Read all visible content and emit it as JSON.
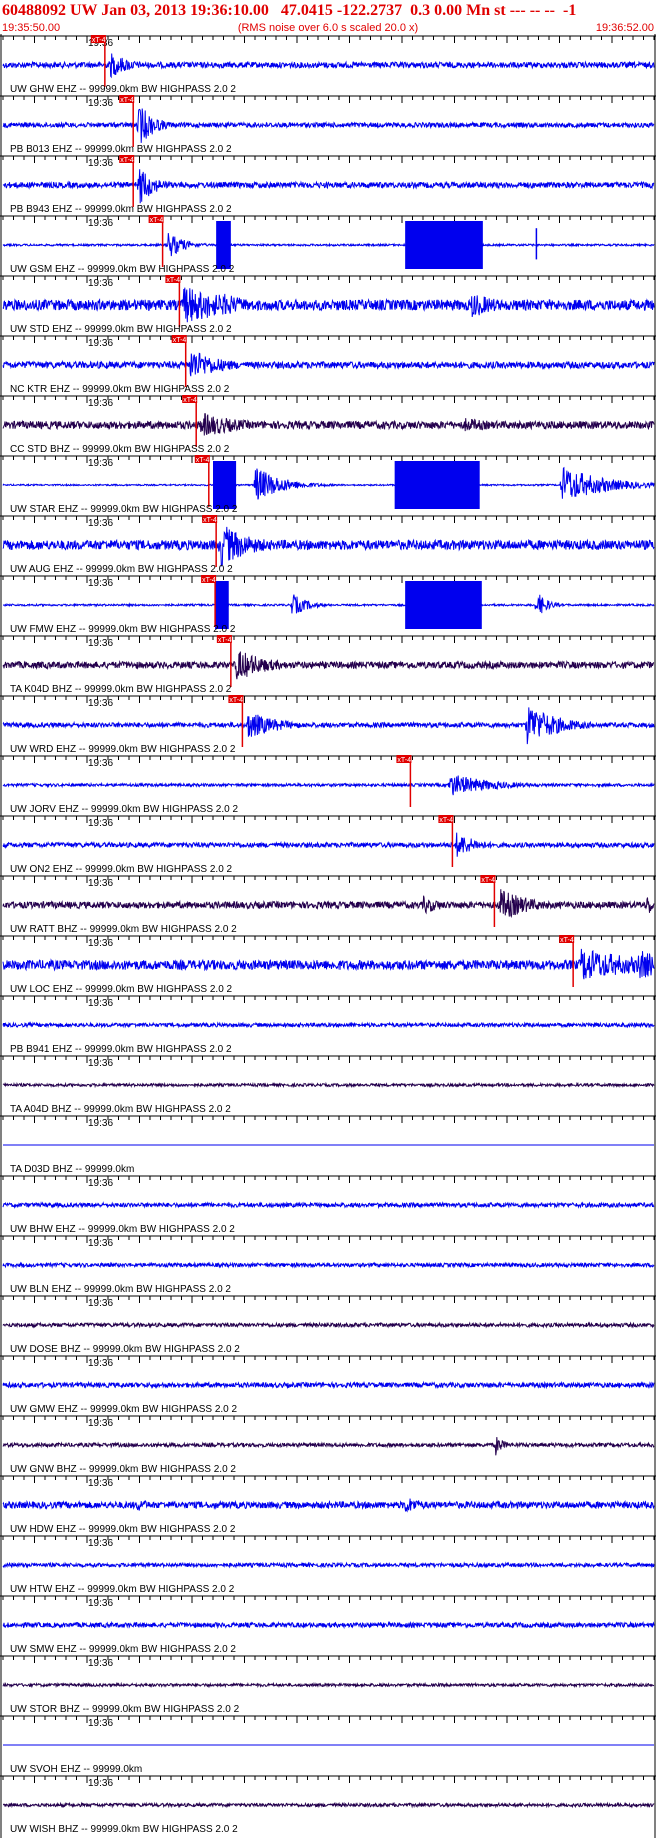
{
  "header": {
    "title": "60488092 UW Jan 03, 2013 19:36:10.00   47.0415 -122.2737  0.3 0.00 Mn st --- -- --  -1",
    "start_time": "19:35:50.00",
    "note": "(RMS noise over 6.0 s scaled 20.0 x)",
    "end_time": "19:36:52.00"
  },
  "chart_data": {
    "type": "line",
    "title": "60488092 UW Jan 03, 2013 19:36:10.00   47.0415 -122.2737  0.3 0.00 Mn st --- -- --  -1",
    "x_start": "19:35:50.00",
    "x_end": "19:36:52.00",
    "x_range_seconds": [
      0,
      62
    ],
    "minute_tick_label": "19:36",
    "minute_tick_time_s": 8,
    "pick_label": "xT-4",
    "colors": {
      "header": "#e00000",
      "trace_blue": "#0000ee",
      "trace_dark": "#24004d",
      "pick": "#e00000",
      "axis": "#000000"
    },
    "traces": [
      {
        "name": "UW GHW EHZ -- 99999.0km BW  HIGHPASS  2.0  2",
        "color": "blue",
        "pick_s": 9.7,
        "noise": 0.12,
        "events": [
          {
            "t": 10.2,
            "amp": 0.55,
            "dur": 2
          }
        ]
      },
      {
        "name": "PB B013 EHZ -- 99999.0km BW  HIGHPASS  2.0  2",
        "color": "blue",
        "pick_s": 12.4,
        "noise": 0.1,
        "events": [
          {
            "t": 12.9,
            "amp": 0.95,
            "dur": 1.5
          }
        ]
      },
      {
        "name": "PB B943 EHZ -- 99999.0km BW  HIGHPASS  2.0  2",
        "color": "blue",
        "pick_s": 12.4,
        "noise": 0.12,
        "events": [
          {
            "t": 12.9,
            "amp": 0.9,
            "dur": 1.5
          }
        ]
      },
      {
        "name": "UW GSM EHZ -- 99999.0km BW  HIGHPASS  2.0  2",
        "color": "blue",
        "pick_s": 15.2,
        "noise": 0.04,
        "events": [
          {
            "t": 15.7,
            "amp": 0.6,
            "dur": 1.5
          }
        ],
        "blocks": [
          [
            20.3,
            21.7
          ],
          [
            38.3,
            45.7
          ]
        ],
        "spikes": [
          50.8
        ]
      },
      {
        "name": "UW STD EHZ -- 99999.0km BW  HIGHPASS  2.0  2",
        "color": "blue",
        "pick_s": 16.8,
        "noise": 0.22,
        "events": [
          {
            "t": 17.2,
            "amp": 0.85,
            "dur": 5
          },
          {
            "t": 21,
            "amp": 0.5,
            "dur": 3
          },
          {
            "t": 44.6,
            "amp": 0.55,
            "dur": 3
          }
        ]
      },
      {
        "name": "NC KTR EHZ -- 99999.0km BW  HIGHPASS  2.0  2",
        "color": "blue",
        "pick_s": 17.4,
        "noise": 0.14,
        "events": [
          {
            "t": 17.8,
            "amp": 0.7,
            "dur": 3
          }
        ]
      },
      {
        "name": "CC STD BHZ -- 99999.0km BW  HIGHPASS  2.0  2",
        "color": "dark",
        "pick_s": 18.4,
        "noise": 0.16,
        "events": [
          {
            "t": 18.8,
            "amp": 0.55,
            "dur": 4
          },
          {
            "t": 44,
            "amp": 0.3,
            "dur": 4
          }
        ]
      },
      {
        "name": "UW STAR EHZ -- 99999.0km BW  HIGHPASS  2.0  2",
        "color": "blue",
        "pick_s": 19.6,
        "noise": 0.03,
        "events": [
          {
            "t": 24,
            "amp": 0.8,
            "dur": 2.5
          },
          {
            "t": 53.2,
            "amp": 0.8,
            "dur": 4
          }
        ],
        "blocks": [
          [
            20,
            22.2
          ],
          [
            37.3,
            45.4
          ]
        ]
      },
      {
        "name": "UW AUG EHZ -- 99999.0km BW  HIGHPASS  2.0  2",
        "color": "blue",
        "pick_s": 20.3,
        "noise": 0.2,
        "events": [
          {
            "t": 20.7,
            "amp": 0.95,
            "dur": 3
          }
        ]
      },
      {
        "name": "UW FMW EHZ -- 99999.0km BW  HIGHPASS  2.0  2",
        "color": "blue",
        "pick_s": 20.2,
        "noise": 0.04,
        "events": [
          {
            "t": 27.5,
            "amp": 0.5,
            "dur": 1.5
          },
          {
            "t": 50.8,
            "amp": 0.6,
            "dur": 1
          }
        ],
        "blocks": [
          [
            20.2,
            21.5
          ],
          [
            38.3,
            45.6
          ]
        ]
      },
      {
        "name": "TA K04D BHZ -- 99999.0km BW  HIGHPASS  2.0  2",
        "color": "dark",
        "pick_s": 21.7,
        "noise": 0.14,
        "events": [
          {
            "t": 22.2,
            "amp": 0.7,
            "dur": 3
          }
        ]
      },
      {
        "name": "UW WRD EHZ -- 99999.0km BW  HIGHPASS  2.0  2",
        "color": "blue",
        "pick_s": 22.8,
        "noise": 0.1,
        "events": [
          {
            "t": 23.3,
            "amp": 0.6,
            "dur": 3
          },
          {
            "t": 49.9,
            "amp": 0.9,
            "dur": 3
          }
        ]
      },
      {
        "name": "UW JORV EHZ -- 99999.0km BW  HIGHPASS  2.0  2",
        "color": "blue",
        "pick_s": 38.8,
        "noise": 0.06,
        "events": [
          {
            "t": 42.5,
            "amp": 0.5,
            "dur": 4
          }
        ]
      },
      {
        "name": "UW ON2 EHZ -- 99999.0km BW  HIGHPASS  2.0  2",
        "color": "blue",
        "pick_s": 42.8,
        "noise": 0.1,
        "events": [
          {
            "t": 43.2,
            "amp": 0.55,
            "dur": 2
          },
          {
            "t": 44.3,
            "amp": 0.3,
            "dur": 2
          }
        ]
      },
      {
        "name": "UW RATT BHZ -- 99999.0km BW  HIGHPASS  2.0  2",
        "color": "dark",
        "pick_s": 46.8,
        "noise": 0.14,
        "events": [
          {
            "t": 47.3,
            "amp": 0.7,
            "dur": 3
          },
          {
            "t": 40,
            "amp": 0.4,
            "dur": 2
          },
          {
            "t": 61.3,
            "amp": 0.5,
            "dur": 1
          }
        ]
      },
      {
        "name": "UW LOC EHZ -- 99999.0km BW  HIGHPASS  2.0  2",
        "color": "blue",
        "pick_s": 54.3,
        "noise": 0.2,
        "events": [
          {
            "t": 55,
            "amp": 0.75,
            "dur": 6
          },
          {
            "t": 60.5,
            "amp": 0.65,
            "dur": 4
          }
        ]
      },
      {
        "name": "PB B941 EHZ -- 99999.0km BW  HIGHPASS  2.0  2",
        "color": "blue",
        "noise": 0.08,
        "events": []
      },
      {
        "name": "TA A04D BHZ -- 99999.0km BW  HIGHPASS  2.0  2",
        "color": "dark",
        "noise": 0.06,
        "events": []
      },
      {
        "name": "TA D03D BHZ -- 99999.0km",
        "color": "blue",
        "noise": 0,
        "events": []
      },
      {
        "name": "UW BHW EHZ -- 99999.0km BW  HIGHPASS  2.0  2",
        "color": "blue",
        "noise": 0.09,
        "events": []
      },
      {
        "name": "UW BLN EHZ -- 99999.0km BW  HIGHPASS  2.0  2",
        "color": "blue",
        "noise": 0.08,
        "events": []
      },
      {
        "name": "UW DOSE BHZ -- 99999.0km BW  HIGHPASS  2.0  2",
        "color": "dark",
        "noise": 0.08,
        "events": []
      },
      {
        "name": "UW GMW EHZ -- 99999.0km BW  HIGHPASS  2.0  2",
        "color": "blue",
        "noise": 0.1,
        "events": []
      },
      {
        "name": "UW GNW BHZ -- 99999.0km BW  HIGHPASS  2.0  2",
        "color": "dark",
        "noise": 0.08,
        "events": [
          {
            "t": 46.9,
            "amp": 0.45,
            "dur": 0.8
          }
        ]
      },
      {
        "name": "UW HDW EHZ -- 99999.0km BW  HIGHPASS  2.0  2",
        "color": "blue",
        "noise": 0.14,
        "events": [
          {
            "t": 12.8,
            "amp": 0.3,
            "dur": 1.5
          },
          {
            "t": 38.2,
            "amp": 0.4,
            "dur": 2
          }
        ]
      },
      {
        "name": "UW HTW EHZ -- 99999.0km BW  HIGHPASS  2.0  2",
        "color": "blue",
        "noise": 0.08,
        "events": []
      },
      {
        "name": "UW SMW EHZ -- 99999.0km BW  HIGHPASS  2.0  2",
        "color": "blue",
        "noise": 0.1,
        "events": []
      },
      {
        "name": "UW STOR BHZ -- 99999.0km BW  HIGHPASS  2.0  2",
        "color": "dark",
        "noise": 0.06,
        "events": []
      },
      {
        "name": "UW SVOH EHZ -- 99999.0km",
        "color": "blue",
        "noise": 0,
        "events": []
      },
      {
        "name": "UW WISH BHZ -- 99999.0km BW  HIGHPASS  2.0  2",
        "color": "dark",
        "noise": 0.07,
        "events": []
      }
    ]
  }
}
